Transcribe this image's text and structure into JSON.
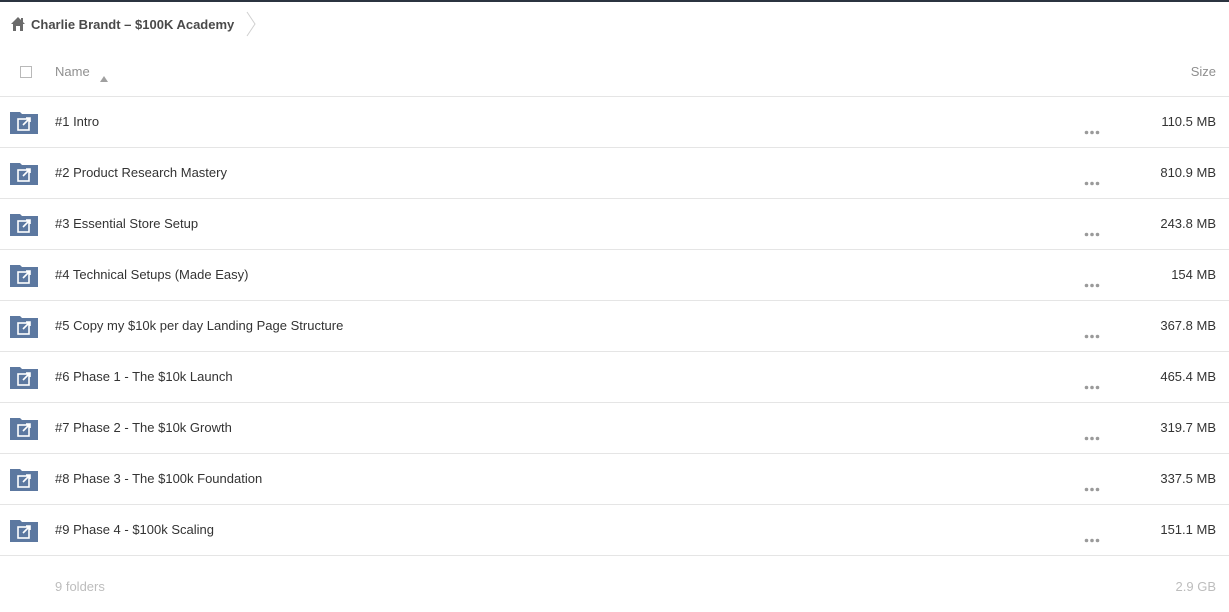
{
  "breadcrumb": {
    "home_icon": "home-icon",
    "label": "Charlie Brandt – $100K Academy"
  },
  "header": {
    "name_label": "Name",
    "size_label": "Size",
    "sort_icon": "sort-ascending-icon"
  },
  "rows": [
    {
      "name": "#1 Intro",
      "size": "110.5 MB"
    },
    {
      "name": "#2 Product Research Mastery",
      "size": "810.9 MB"
    },
    {
      "name": "#3 Essential Store Setup",
      "size": "243.8 MB"
    },
    {
      "name": "#4 Technical Setups (Made Easy)",
      "size": "154 MB"
    },
    {
      "name": "#5 Copy my $10k per day Landing Page Structure",
      "size": "367.8 MB"
    },
    {
      "name": "#6 Phase 1 - The $10k Launch",
      "size": "465.4 MB"
    },
    {
      "name": "#7 Phase 2 - The $10k Growth",
      "size": "319.7 MB"
    },
    {
      "name": "#8 Phase 3 - The $100k Foundation",
      "size": "337.5 MB"
    },
    {
      "name": "#9 Phase 4 - $100k Scaling",
      "size": "151.1 MB"
    }
  ],
  "footer": {
    "count": "9 folders",
    "total_size": "2.9 GB"
  },
  "colors": {
    "folder": "#5c78a0",
    "text": "#333333",
    "muted": "#8f8f8f",
    "divider": "#e5e5e5"
  }
}
